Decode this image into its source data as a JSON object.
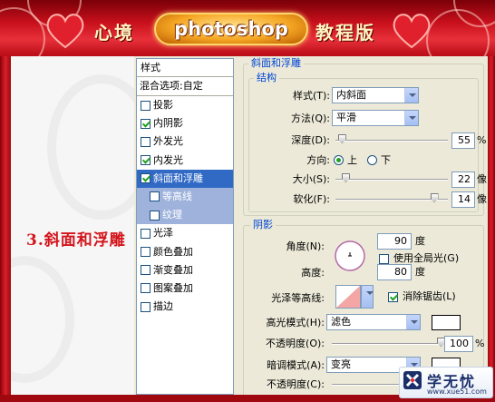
{
  "banner": {
    "left_text": "心境",
    "logo_text": "photoshop",
    "right_text": "教程版"
  },
  "caption": "3.斜面和浮雕",
  "style_list": {
    "header": "样式",
    "blend_options": "混合选项:自定",
    "items": [
      {
        "label": "投影",
        "checked": false
      },
      {
        "label": "内阴影",
        "checked": true
      },
      {
        "label": "外发光",
        "checked": false
      },
      {
        "label": "内发光",
        "checked": true
      },
      {
        "label": "斜面和浮雕",
        "checked": true,
        "selected": true
      },
      {
        "label": "等高线",
        "checked": false,
        "sub": true
      },
      {
        "label": "纹理",
        "checked": false,
        "sub": true
      },
      {
        "label": "光泽",
        "checked": false
      },
      {
        "label": "颜色叠加",
        "checked": false
      },
      {
        "label": "渐变叠加",
        "checked": false
      },
      {
        "label": "图案叠加",
        "checked": false
      },
      {
        "label": "描边",
        "checked": false
      }
    ]
  },
  "bevel": {
    "section_title": "斜面和浮雕",
    "structure_title": "结构",
    "style_label": "样式(T):",
    "style_value": "内斜面",
    "technique_label": "方法(Q):",
    "technique_value": "平滑",
    "depth_label": "深度(D):",
    "depth_value": "55",
    "depth_unit": "%",
    "depth_fraction": 0.055,
    "direction_label": "方向:",
    "direction_up": "上",
    "direction_down": "下",
    "direction_selected": "上",
    "size_label": "大小(S):",
    "size_value": "22",
    "size_unit": "像",
    "size_fraction": 0.088,
    "soften_label": "软化(F):",
    "soften_value": "14",
    "soften_unit": "像",
    "soften_fraction": 0.875
  },
  "shading": {
    "title": "阴影",
    "angle_label": "角度(N):",
    "angle_value": "90",
    "angle_unit": "度",
    "global_light_label": "使用全局光(G)",
    "global_light_checked": false,
    "altitude_label": "高度:",
    "altitude_value": "80",
    "altitude_unit": "度",
    "gloss_label": "光泽等高线:",
    "anti_alias_label": "消除锯齿(L)",
    "anti_alias_checked": true,
    "highlight_mode_label": "高光模式(H):",
    "highlight_mode_value": "滤色",
    "highlight_color": "#ffffff",
    "highlight_opacity_label": "不透明度(O):",
    "highlight_opacity_value": "100",
    "highlight_opacity_unit": "%",
    "highlight_opacity_fraction": 1.0,
    "shadow_mode_label": "暗调模式(A):",
    "shadow_mode_value": "变亮",
    "shadow_color": "#ffffff",
    "shadow_opacity_label": "不透明度(C):"
  },
  "watermark": {
    "title": "学无忧",
    "url": "www.xue51.com"
  },
  "colors": {
    "frame_red": "#c8101c",
    "selection_blue": "#316ac5",
    "caption_red": "#d4141c"
  }
}
